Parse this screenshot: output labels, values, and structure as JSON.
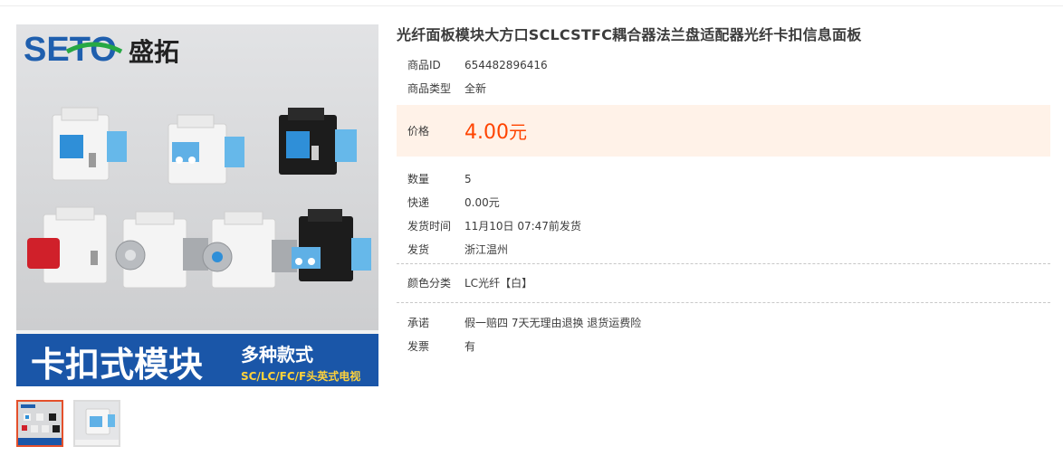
{
  "product": {
    "title": "光纤面板模块大方口SCLCSTFC耦合器法兰盘适配器光纤卡扣信息面板",
    "fields": {
      "id_label": "商品ID",
      "id_value": "654482896416",
      "type_label": "商品类型",
      "type_value": "全新",
      "price_label": "价格",
      "price_value": "4.00",
      "price_unit": "元",
      "qty_label": "数量",
      "qty_value": "5",
      "shipping_label": "快递",
      "shipping_value": "0.00元",
      "ship_time_label": "发货时间",
      "ship_time_value": "11月10日 07:47前发货",
      "origin_label": "发货",
      "origin_value": "浙江温州",
      "color_label": "颜色分类",
      "color_value": "LC光纤【白】",
      "promise_label": "承诺",
      "promise_value": "假一赔四 7天无理由退换 退货运费险",
      "invoice_label": "发票",
      "invoice_value": "有"
    }
  },
  "image": {
    "brand_latin": "SETO",
    "brand_cn": "盛拓",
    "banner_main": "卡扣式模块",
    "banner_sub1": "多种款式",
    "banner_sub2": "SC/LC/FC/F头英式电视"
  },
  "colors": {
    "price": "#ff4400",
    "price_bg": "#fff2e8",
    "thumb_active_border": "#e4502b",
    "banner_blue": "#1a56a8"
  }
}
